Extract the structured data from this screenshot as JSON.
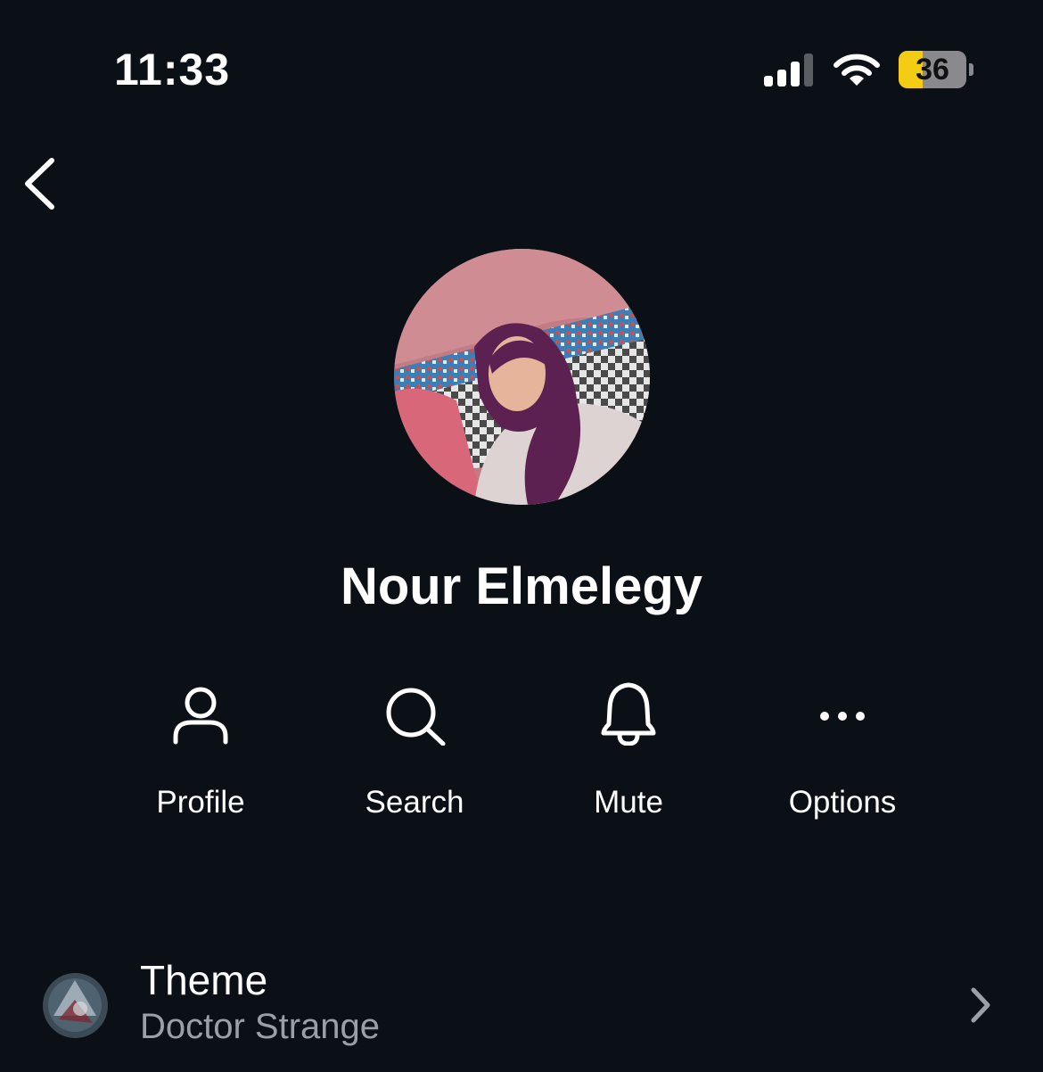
{
  "status_bar": {
    "time": "11:33",
    "battery_level": "36",
    "battery_fraction": 0.36,
    "signal_bars_active": 3,
    "signal_bars_total": 4,
    "signal_icon": "cellular-signal-icon",
    "wifi_icon": "wifi-icon"
  },
  "nav": {
    "back_icon": "chevron-left-icon"
  },
  "profile": {
    "name": "Nour Elmelegy"
  },
  "actions": [
    {
      "id": "profile",
      "label": "Profile",
      "icon": "person-icon"
    },
    {
      "id": "search",
      "label": "Search",
      "icon": "magnifier-icon"
    },
    {
      "id": "mute",
      "label": "Mute",
      "icon": "bell-icon"
    },
    {
      "id": "options",
      "label": "Options",
      "icon": "ellipsis-icon"
    }
  ],
  "settings": {
    "theme": {
      "title": "Theme",
      "value": "Doctor Strange",
      "chevron_icon": "chevron-right-icon"
    }
  },
  "colors": {
    "background": "#0b1017",
    "text_primary": "#ffffff",
    "text_secondary": "#9ba0a8",
    "battery_fill": "#f5cc14"
  }
}
